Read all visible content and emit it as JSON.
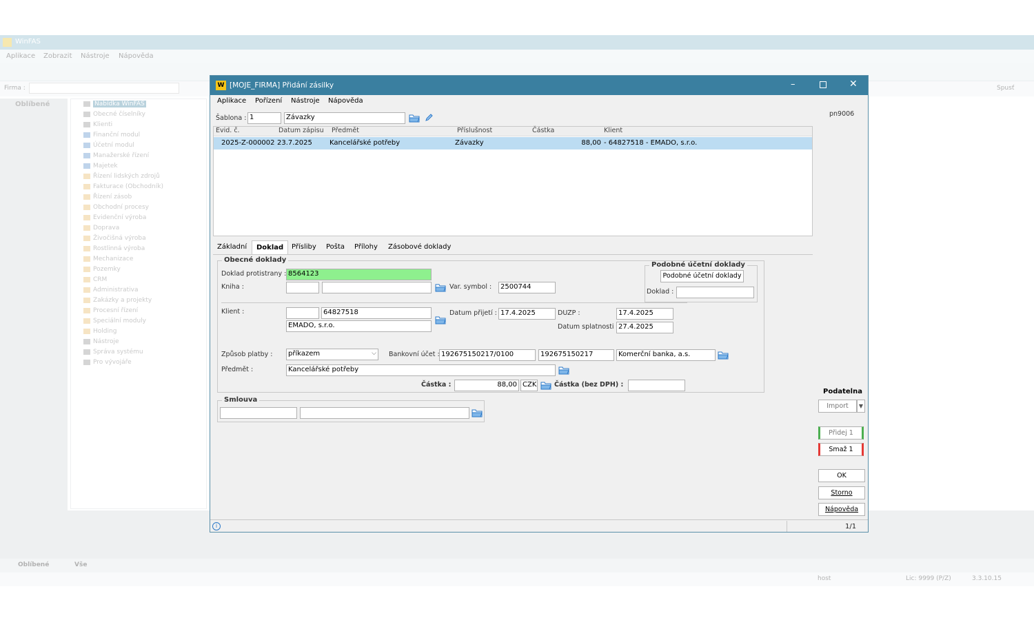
{
  "background_app": {
    "title": "WinFAS",
    "menu": [
      "Aplikace",
      "Zobrazit",
      "Nástroje",
      "Nápověda"
    ],
    "firma_label": "Firma :",
    "spust_label": "Spusť",
    "left_panel_title": "Oblíbené",
    "tree_root": "Nabídka WinFAS",
    "tree_items": [
      "Obecné číselníky",
      "Klienti",
      "Finanční modul",
      "Účetní modul",
      "Manažerské řízení",
      "Majetek",
      "Řízení lidských zdrojů",
      "Fakturace (Obchodník)",
      "Řízení zásob",
      "Obchodní procesy",
      "Evidenční výroba",
      "Doprava",
      "Živočišná výroba",
      "Rostlinná výroba",
      "Mechanizace",
      "Pozemky",
      "CRM",
      "Administrativa",
      "Zakázky a projekty",
      "Procesní řízení",
      "Speciální moduly",
      "Holding",
      "Nástroje",
      "Správa systému",
      "Pro vývojáře"
    ],
    "bottom_tabs": [
      "Oblíbené",
      "Vše"
    ],
    "status_user": "host",
    "status_lic": "Lic: 9999 (P/Z)",
    "status_version": "3.3.10.15"
  },
  "dialog": {
    "title": "[MOJE_FIRMA] Přidání zásilky",
    "menu": [
      "Aplikace",
      "Pořízení",
      "Nástroje",
      "Nápověda"
    ],
    "sablona_label": "Šablona :",
    "sablona_value": "1",
    "sablona_name": "Závazky",
    "user_code": "pn9006",
    "grid": {
      "headers": [
        "Evid. č.",
        "Datum zápisu",
        "Předmět",
        "Příslušnost",
        "Částka",
        "Klient"
      ],
      "row": [
        "2025-Z-000002",
        "23.7.2025",
        "Kancelářské potřeby",
        "Závazky",
        "88,00",
        "- 64827518  - EMADO, s.r.o."
      ]
    },
    "tabs": [
      "Základní",
      "Doklad",
      "Přísliby",
      "Pošta",
      "Přílohy",
      "Zásobové doklady"
    ],
    "obecne": {
      "title": "Obecné doklady",
      "doklad_protistrany_label": "Doklad protistrany :",
      "doklad_protistrany_value": "8564123",
      "kniha_label": "Kniha  :",
      "var_symbol_label": "Var. symbol :",
      "var_symbol_value": "2500744",
      "klient_label": "Klient :",
      "klient_code": "64827518",
      "klient_name": "EMADO, s.r.o.",
      "datum_prijeti_label": "Datum přijetí :",
      "datum_prijeti_value": "17.4.2025",
      "duzp_label": "DUZP :",
      "duzp_value": "17.4.2025",
      "datum_splatnosti_label": "Datum splatnosti :",
      "datum_splatnosti_value": "27.4.2025",
      "zpusob_platby_label": "Způsob platby :",
      "zpusob_platby_value": "příkazem",
      "bankovni_ucet_label": "Bankovní účet :",
      "bankovni_ucet_value": "192675150217/0100",
      "ucet_cislo": "192675150217",
      "banka": "Komerční banka, a.s.",
      "predmet_label": "Předmět :",
      "predmet_value": "Kancelářské potřeby",
      "castka_label": "Částka :",
      "castka_value": "88,00",
      "mena": "CZK",
      "castka_bez_dph_label": "Částka (bez DPH) :"
    },
    "podobne": {
      "title": "Podobné účetní doklady",
      "button": "Podobné účetní doklady",
      "doklad_label": "Doklad :"
    },
    "smlouva_title": "Smlouva",
    "side": {
      "podatelna": "Podatelna",
      "import": "Import",
      "pridej": "Přidej 1",
      "smaz": "Smaž 1",
      "ok": "OK",
      "storno": "Storno",
      "napoveda": "Nápověda"
    },
    "status_page": "1/1"
  }
}
